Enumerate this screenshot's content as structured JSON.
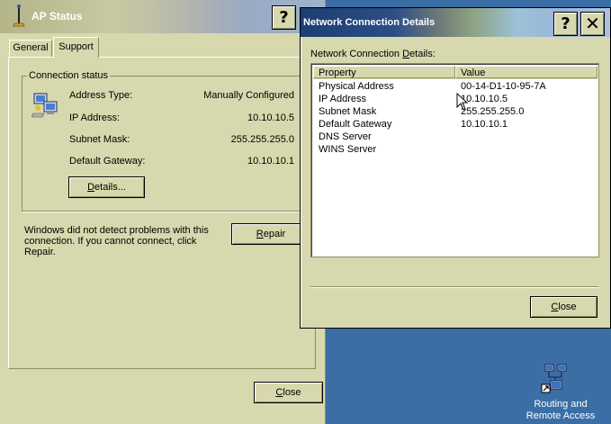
{
  "ap_window": {
    "title": "AP Status",
    "help_glyph": "?",
    "tabs": [
      {
        "label": "General",
        "selected": false
      },
      {
        "label": "Support",
        "selected": true
      }
    ],
    "connection_status": {
      "group_label": "Connection status",
      "rows": [
        {
          "label": "Address Type:",
          "value": "Manually Configured"
        },
        {
          "label": "IP Address:",
          "value": "10.10.10.5"
        },
        {
          "label": "Subnet Mask:",
          "value": "255.255.255.0"
        },
        {
          "label": "Default Gateway:",
          "value": "10.10.10.1"
        }
      ],
      "details_button": {
        "prefix": "",
        "accel": "D",
        "rest": "etails..."
      }
    },
    "problem_text": "Windows did not detect problems with this connection. If you cannot connect, click Repair.",
    "repair_button": {
      "accel": "R",
      "rest": "epair"
    },
    "close_button": {
      "accel": "C",
      "rest": "lose"
    }
  },
  "ncd_window": {
    "title": "Network Connection Details",
    "help_glyph": "?",
    "close_glyph": "✕",
    "label_prefix": "Network Connection ",
    "label_accel": "D",
    "label_rest": "etails:",
    "columns": [
      "Property",
      "Value"
    ],
    "rows": [
      {
        "property": "Physical Address",
        "value": "00-14-D1-10-95-7A"
      },
      {
        "property": "IP Address",
        "value": "10.10.10.5"
      },
      {
        "property": "Subnet Mask",
        "value": "255.255.255.0"
      },
      {
        "property": "Default Gateway",
        "value": "10.10.10.1"
      },
      {
        "property": "DNS Server",
        "value": ""
      },
      {
        "property": "WINS Server",
        "value": ""
      }
    ],
    "close_button": {
      "accel": "C",
      "rest": "lose"
    }
  },
  "desktop": {
    "icon": "network-computers-icon",
    "label_line1": "Routing and",
    "label_line2": "Remote Access"
  },
  "colors": {
    "desktop": "#3a6ea5",
    "window_face": "#d8d8ae",
    "shadow": "#8c8c6a"
  }
}
